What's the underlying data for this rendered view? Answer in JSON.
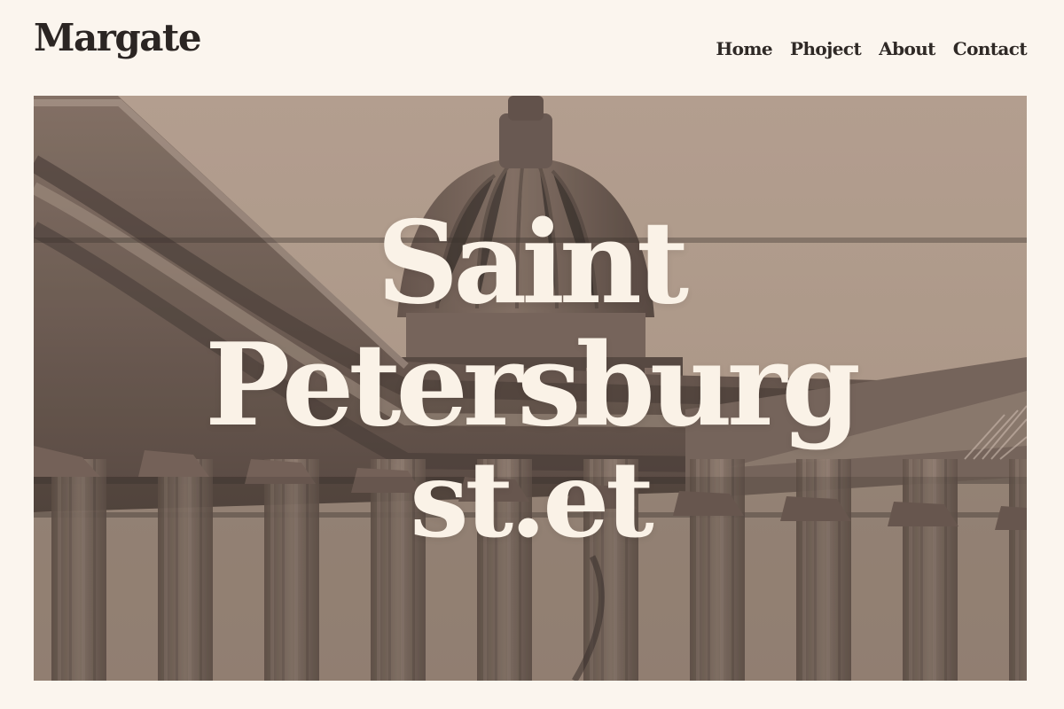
{
  "brand": {
    "logo": "Margate"
  },
  "nav": {
    "items": [
      {
        "label": "Home"
      },
      {
        "label": "Phoject"
      },
      {
        "label": "About"
      },
      {
        "label": "Contact"
      }
    ]
  },
  "hero": {
    "line1": "Saint",
    "line2": "Petersburg",
    "line3": "st.et"
  },
  "colors": {
    "page_background": "#fbf5ee",
    "ink": "#2b2523",
    "hero_text": "#faf2e7",
    "photo_tone": "#a79282"
  }
}
